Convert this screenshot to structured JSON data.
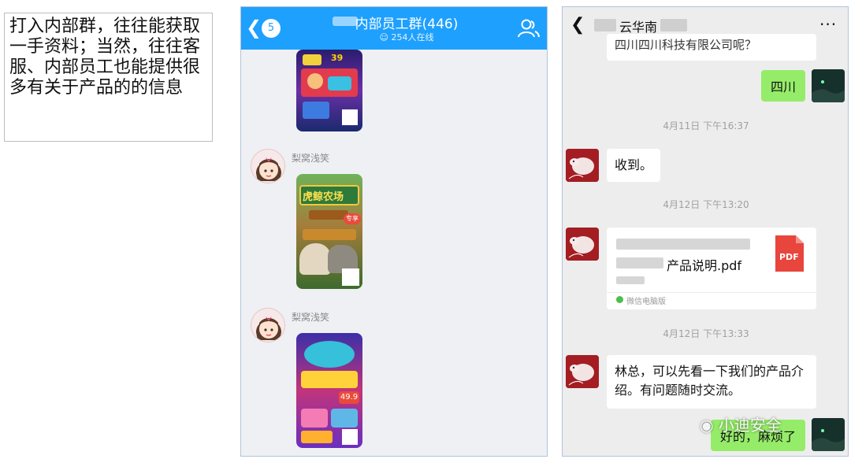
{
  "note": {
    "text": "打入内部群，往往能获取一手资料；当然，往往客服、内部员工也能提供很多有关于产品的的信息"
  },
  "qq": {
    "back_badge": "5",
    "title": "内部员工群(446)",
    "online": "254人在线",
    "messages": [
      {
        "sender": "梨窝浅笑"
      },
      {
        "sender": "梨窝浅笑"
      }
    ],
    "poster_top": {
      "price": "39"
    },
    "poster_mid": {
      "title": "虎鲸农场",
      "badge": "专享"
    },
    "poster_bottom": {
      "price": "49.9"
    }
  },
  "wechat": {
    "contact_name": "云华南",
    "more": "···",
    "first_partial": "四川四川科技有限公司呢？",
    "reply_sichuan": "四川",
    "time_1": "4月11日 下午16:37",
    "msg_received": "收到。",
    "time_2": "4月12日 下午13:20",
    "file": {
      "name": "产品说明.pdf",
      "icon_label": "PDF",
      "source": "微信电脑版"
    },
    "time_3": "4月12日 下午13:33",
    "msg_long": "林总，可以先看一下我们的产品介绍。有问题随时交流。",
    "reply_last": "好的，麻烦了"
  },
  "watermark": "小迪安全",
  "colors": {
    "qq_blue": "#1ea0ff",
    "wechat_green": "#95ec69",
    "pdf_red": "#e8453c"
  }
}
